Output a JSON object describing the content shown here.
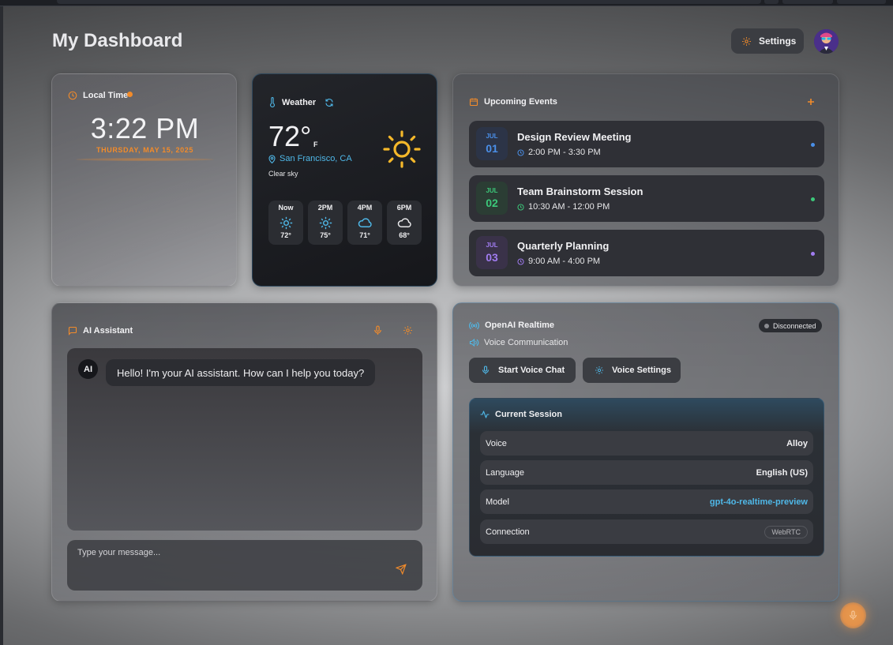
{
  "header": {
    "title": "My Dashboard",
    "settings_label": "Settings"
  },
  "local_time": {
    "label": "Local Time",
    "time": "3:22 PM",
    "date": "THURSDAY, MAY 15, 2025"
  },
  "weather": {
    "label": "Weather",
    "temperature": "72°",
    "unit": "F",
    "location": "San Francisco, CA",
    "condition": "Clear sky",
    "forecast": [
      {
        "time": "Now",
        "icon": "sun-icon",
        "temp": "72°"
      },
      {
        "time": "2PM",
        "icon": "sun-icon",
        "temp": "75°"
      },
      {
        "time": "4PM",
        "icon": "cloud-icon",
        "temp": "71°"
      },
      {
        "time": "6PM",
        "icon": "cloud-icon",
        "temp": "68°"
      }
    ]
  },
  "events": {
    "label": "Upcoming Events",
    "items": [
      {
        "month": "JUL",
        "day": "01",
        "title": "Design Review Meeting",
        "time": "2:00 PM - 3:30 PM",
        "color": "#4a8fe8"
      },
      {
        "month": "JUL",
        "day": "02",
        "title": "Team Brainstorm Session",
        "time": "10:30 AM - 12:00 PM",
        "color": "#3cc87a"
      },
      {
        "month": "JUL",
        "day": "03",
        "title": "Quarterly Planning",
        "time": "9:00 AM - 4:00 PM",
        "color": "#a07cf0"
      }
    ]
  },
  "assistant": {
    "label": "AI Assistant",
    "avatar": "AI",
    "message": "Hello! I'm your AI assistant. How can I help you today?",
    "input_placeholder": "Type your message..."
  },
  "realtime": {
    "label": "OpenAI Realtime",
    "status": "Disconnected",
    "subtitle": "Voice Communication",
    "start_label": "Start Voice Chat",
    "settings_label": "Voice Settings",
    "session_label": "Current Session",
    "rows": [
      {
        "key": "Voice",
        "value": "Alloy"
      },
      {
        "key": "Language",
        "value": "English (US)"
      },
      {
        "key": "Model",
        "value": "gpt-4o-realtime-preview"
      },
      {
        "key": "Connection",
        "value": "WebRTC"
      }
    ]
  },
  "colors": {
    "accent": "#f28b2a",
    "link": "#4fb8e8"
  }
}
